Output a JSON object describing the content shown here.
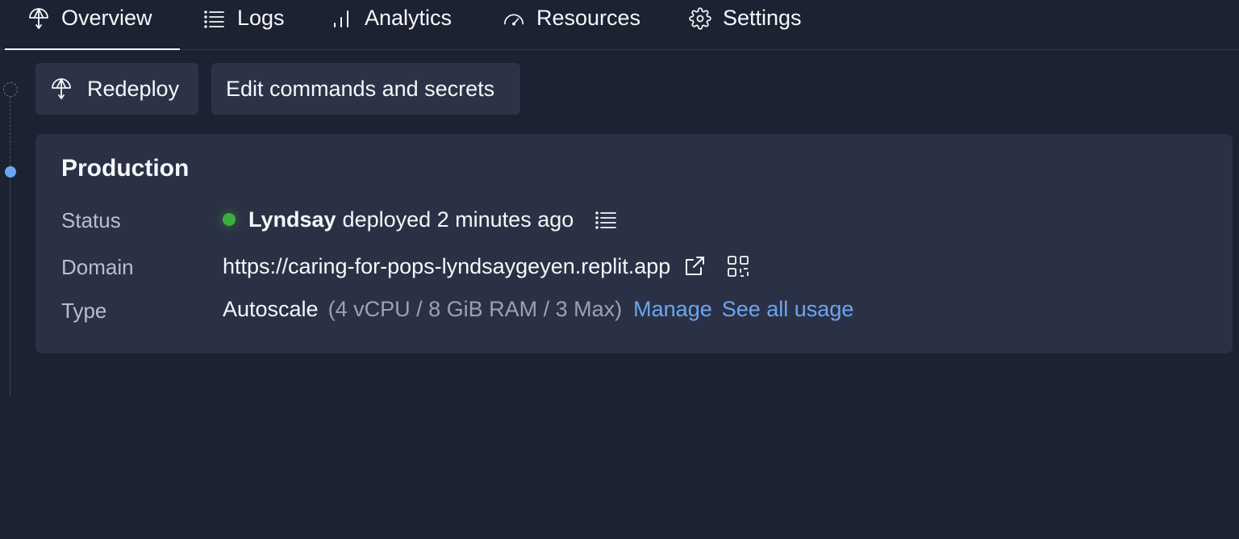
{
  "tabs": [
    {
      "label": "Overview",
      "icon": "deploy-icon",
      "active": true
    },
    {
      "label": "Logs",
      "icon": "list-icon"
    },
    {
      "label": "Analytics",
      "icon": "bar-chart-icon"
    },
    {
      "label": "Resources",
      "icon": "gauge-icon"
    },
    {
      "label": "Settings",
      "icon": "gear-icon"
    }
  ],
  "actions": {
    "redeploy_label": "Redeploy",
    "edit_label": "Edit commands and secrets"
  },
  "card": {
    "title": "Production",
    "status": {
      "label": "Status",
      "user": "Lyndsay",
      "text": "deployed 2 minutes ago",
      "dot_color": "#3cae3c"
    },
    "domain": {
      "label": "Domain",
      "url": "https://caring-for-pops-lyndsaygeyen.replit.app"
    },
    "type": {
      "label": "Type",
      "value": "Autoscale",
      "spec": "(4 vCPU / 8 GiB RAM / 3 Max)",
      "manage_label": "Manage",
      "usage_label": "See all usage"
    }
  },
  "colors": {
    "background": "#1c2232",
    "card": "#2b3145",
    "button": "#2d3347",
    "accent": "#6ba6f2"
  }
}
